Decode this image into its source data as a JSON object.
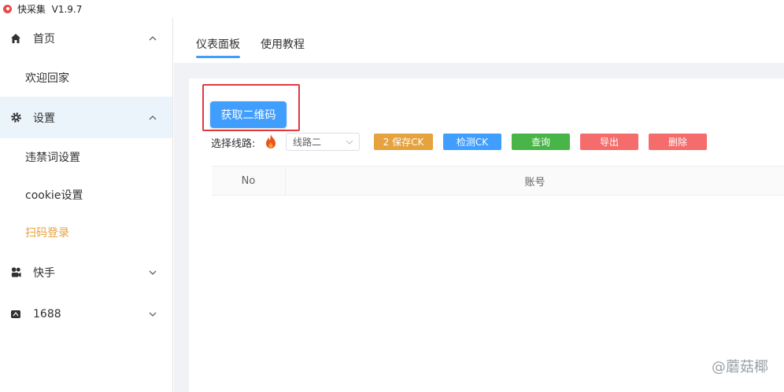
{
  "window": {
    "title": "快采集  V1.9.7"
  },
  "sidebar": {
    "groups": [
      {
        "label": "首页",
        "icon": "home-icon",
        "items": [
          "欢迎回家"
        ]
      },
      {
        "label": "设置",
        "icon": "gear-icon",
        "items": [
          "违禁词设置",
          "cookie设置",
          "扫码登录"
        ]
      },
      {
        "label": "快手",
        "icon": "kuaishou-icon",
        "items": []
      },
      {
        "label": "1688",
        "icon": "store-icon",
        "items": []
      }
    ],
    "active_item": "扫码登录"
  },
  "tabs": [
    {
      "label": "仪表面板",
      "active": true
    },
    {
      "label": "使用教程",
      "active": false
    }
  ],
  "dashboard": {
    "qr_button": "获取二维码",
    "route_label": "选择线路:",
    "route_value": "线路二",
    "buttons": [
      {
        "label": "2 保存CK",
        "color": "#e6a23c"
      },
      {
        "label": "检测CK",
        "color": "#409eff"
      },
      {
        "label": "查询",
        "color": "#48b548"
      },
      {
        "label": "导出",
        "color": "#f56c6c"
      },
      {
        "label": "删除",
        "color": "#f56c6c"
      }
    ],
    "table": {
      "columns": [
        "No",
        "账号"
      ],
      "rows": []
    }
  },
  "watermark": "@蘑菇椰",
  "colors": {
    "primary": "#409eff",
    "active_menu": "#e6a23c",
    "highlight": "#e0393e"
  }
}
